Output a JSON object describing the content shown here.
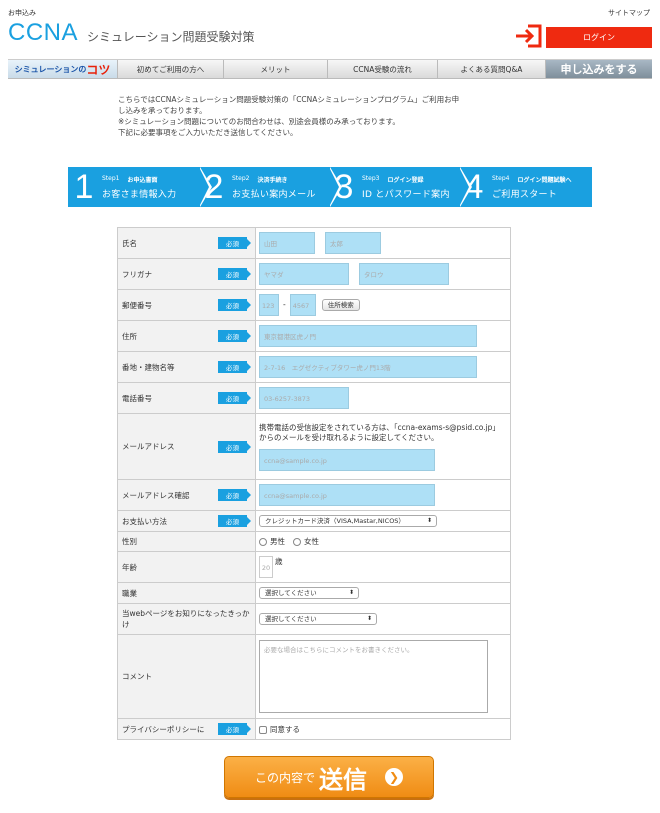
{
  "header": {
    "top_left": "お申込み",
    "top_right": "サイトマップ",
    "logo": "CCNA",
    "logo_sub": "シミュレーション問題受験対策",
    "login_label": "ログイン"
  },
  "nav": {
    "brand_prefix": "シミュレーションの",
    "brand_highlight": "コツ",
    "items": [
      "初めてご利用の方へ",
      "メリット",
      "CCNA受験の流れ",
      "よくある質問Q&A"
    ],
    "apply": "申し込みをする"
  },
  "intro": {
    "line1": "こちらではCCNAシミュレーション問題受験対策の「CCNAシミュレーションプログラム」ご利用お申",
    "line2": "し込みを承っております。",
    "line3": "※シミュレーション問題についてのお問合わせは、別途会員様のみ承っております。",
    "line4": "下記に必要事項をご入力いただき送信してください。"
  },
  "steps": [
    {
      "num": "1",
      "step": "Step1",
      "tag": "お申込書面",
      "label": "お客さま情報入力"
    },
    {
      "num": "2",
      "step": "Step2",
      "tag": "決済手続き",
      "label": "お支払い案内メール"
    },
    {
      "num": "3",
      "step": "Step3",
      "tag": "ログイン登録",
      "label": "ID とパスワード案内"
    },
    {
      "num": "4",
      "step": "Step4",
      "tag": "ログイン問題試験へ",
      "label": "ご利用スタート"
    }
  ],
  "form": {
    "required": "必須",
    "name": {
      "label": "氏名",
      "ph1": "山田",
      "ph2": "太郎"
    },
    "kana": {
      "label": "フリガナ",
      "ph1": "ヤマダ",
      "ph2": "タロウ"
    },
    "zip": {
      "label": "郵便番号",
      "ph1": "123",
      "dash": "-",
      "ph2": "4567",
      "button": "住所検索"
    },
    "address": {
      "label": "住所",
      "ph": "東京都港区虎ノ門"
    },
    "building": {
      "label": "番地・建物名等",
      "ph": "2-7-16　エグゼクティブタワー虎ノ門13階"
    },
    "phone": {
      "label": "電話番号",
      "ph": "03-6257-3873"
    },
    "email": {
      "label": "メールアドレス",
      "note": "携帯電話の受信設定をされている方は、「ccna-exams-s@psid.co.jp」からのメールを受け取れるように設定してください。",
      "ph": "ccna@sample.co.jp"
    },
    "email_confirm": {
      "label": "メールアドレス確認",
      "ph": "ccna@sample.co.jp"
    },
    "payment": {
      "label": "お支払い方法",
      "value": "クレジットカード決済（VISA,Mastar,NICOS）"
    },
    "gender": {
      "label": "性別",
      "male": "男性",
      "female": "女性"
    },
    "age": {
      "label": "年齢",
      "ph": "20",
      "unit": "歳"
    },
    "job": {
      "label": "職業",
      "value": "選択してください"
    },
    "source": {
      "label": "当webページをお知りになったきっかけ",
      "value": "選択してください"
    },
    "comment": {
      "label": "コメント",
      "ph": "必要な場合はこちらにコメントをお書きください。"
    },
    "privacy": {
      "label": "プライバシーポリシーに",
      "agree": "同意する"
    }
  },
  "submit": {
    "prefix": "この内容で",
    "main": "送信",
    "arrow": "❯"
  }
}
